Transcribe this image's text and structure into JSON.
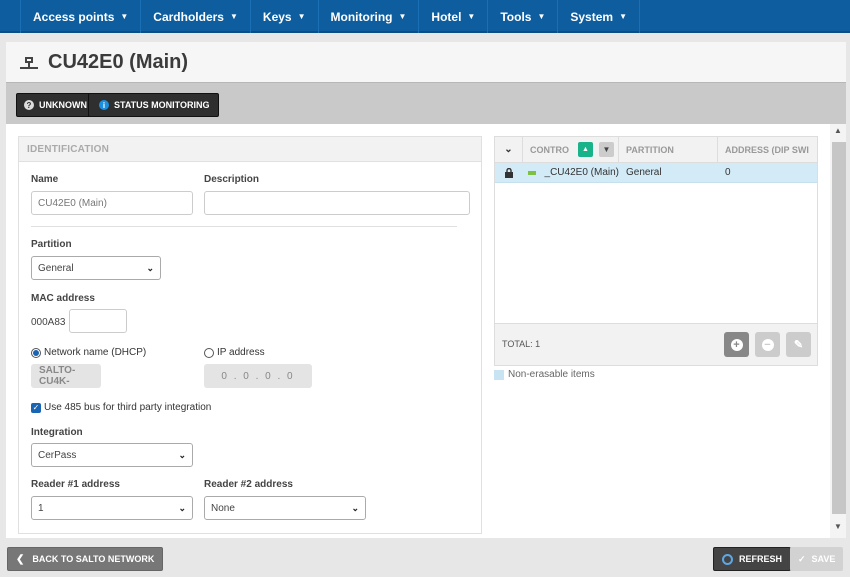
{
  "nav": {
    "items": [
      {
        "label": "Access points"
      },
      {
        "label": "Cardholders"
      },
      {
        "label": "Keys"
      },
      {
        "label": "Monitoring"
      },
      {
        "label": "Hotel"
      },
      {
        "label": "Tools"
      },
      {
        "label": "System"
      }
    ]
  },
  "page": {
    "title": "CU42E0 (Main)"
  },
  "status": {
    "unknown_label": "UNKNOWN",
    "monitoring_label": "STATUS MONITORING"
  },
  "identification": {
    "header": "IDENTIFICATION",
    "name_label": "Name",
    "name_value": "CU42E0 (Main)",
    "description_label": "Description",
    "description_value": "",
    "partition_label": "Partition",
    "partition_value": "General",
    "mac_label": "MAC address",
    "mac_prefix": "000A83",
    "mac_value": "",
    "dhcp_label": "Network name (DHCP)",
    "ip_label": "IP address",
    "network_name_value": "SALTO-CU4K-",
    "ip_value": "0 . 0 . 0 . 0",
    "bus_label": "Use 485 bus for third party integration",
    "integration_label": "Integration",
    "integration_value": "CerPass",
    "reader1_label": "Reader #1 address",
    "reader1_value": "1",
    "reader2_label": "Reader #2 address",
    "reader2_value": "None"
  },
  "table": {
    "columns": [
      "CONTRO",
      "PARTITION",
      "ADDRESS (DIP SWI"
    ],
    "rows": [
      {
        "controller": "_CU42E0 (Main)",
        "partition": "General",
        "address": "0"
      }
    ],
    "total": "TOTAL: 1"
  },
  "legend": {
    "label": "Non-erasable items"
  },
  "buttons": {
    "back_label": "BACK TO SALTO NETWORK",
    "refresh_label": "REFRESH",
    "save_label": "SAVE"
  },
  "colors": {
    "nav_bg": "#0d5d9f",
    "accent_blue": "#1a64b4",
    "selected_row": "#d3ebf7",
    "sort_green": "#19b38a"
  }
}
